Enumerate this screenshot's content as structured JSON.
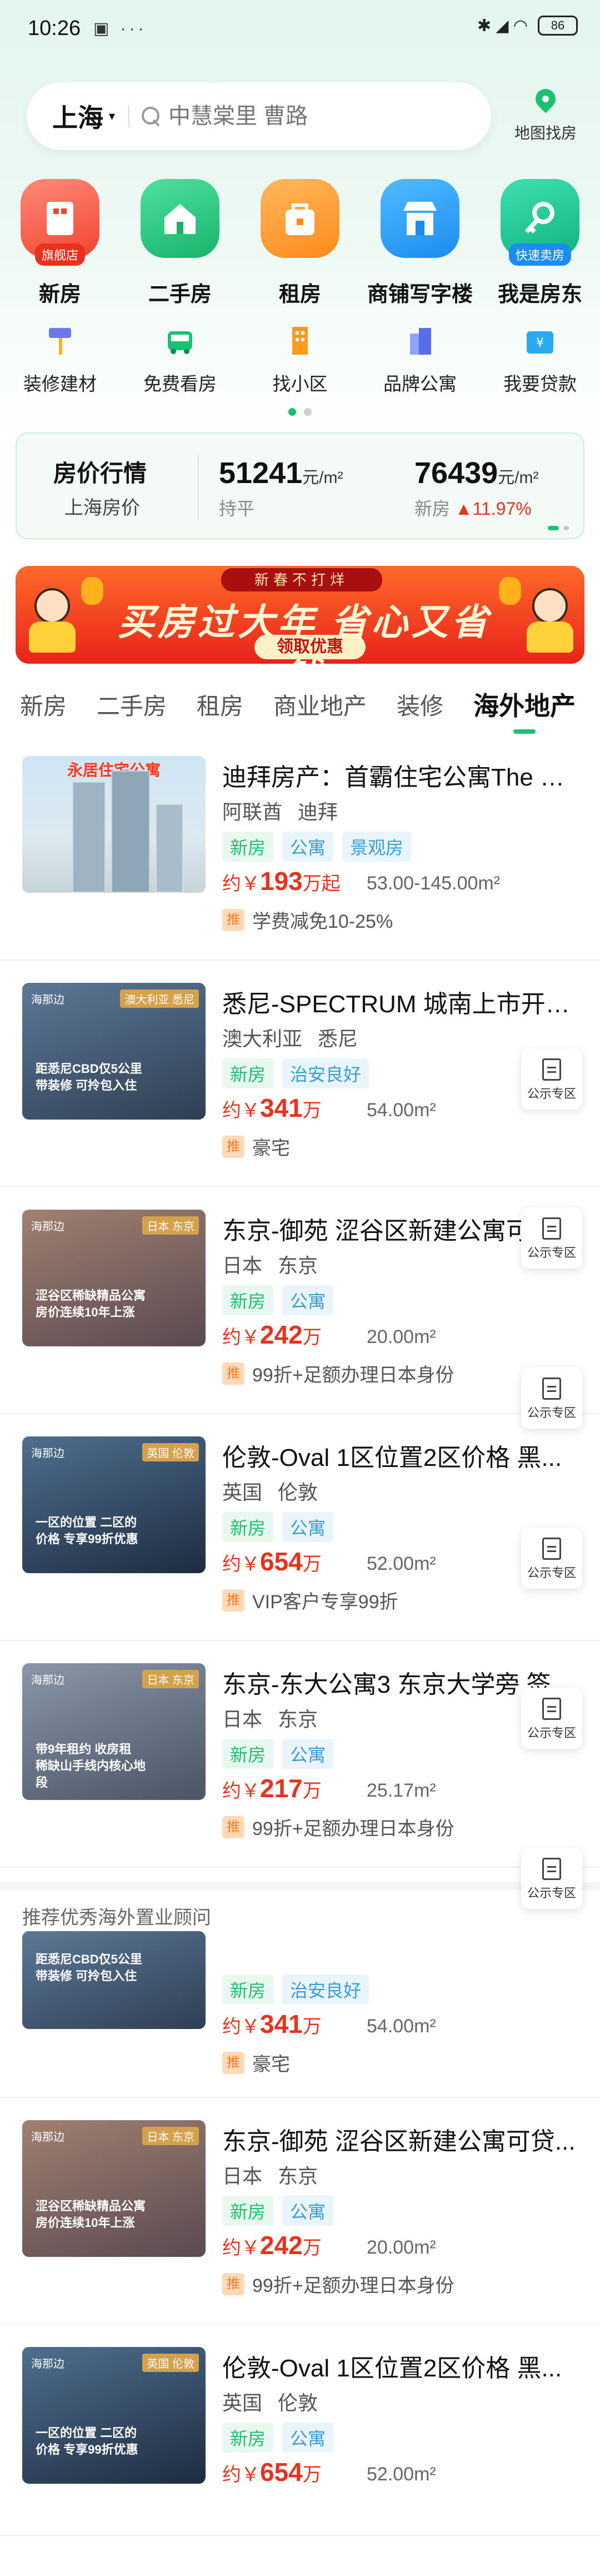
{
  "status": {
    "time": "10:26",
    "left_icons": "▣ ···",
    "right_icons": "✱ ◢ ◠",
    "battery": "86"
  },
  "search": {
    "city": "上海",
    "placeholder": "中慧棠里 曹路",
    "map_label": "地图找房"
  },
  "main_icons": [
    {
      "label": "新房",
      "badge": "旗舰店",
      "icon": "building-icon"
    },
    {
      "label": "二手房",
      "icon": "house-icon"
    },
    {
      "label": "租房",
      "icon": "bag-icon"
    },
    {
      "label": "商铺写字楼",
      "icon": "shop-icon"
    },
    {
      "label": "我是房东",
      "badge": "快速卖房",
      "icon": "key-icon"
    }
  ],
  "sub_icons": [
    {
      "label": "装修建材",
      "icon": "roller-icon"
    },
    {
      "label": "免费看房",
      "icon": "car-icon"
    },
    {
      "label": "找小区",
      "icon": "community-icon"
    },
    {
      "label": "品牌公寓",
      "icon": "apartment-icon"
    },
    {
      "label": "我要贷款",
      "icon": "loan-icon"
    }
  ],
  "price_card": {
    "title": "房价行情",
    "subtitle": "上海房价",
    "value1": "51241",
    "unit": "元/m²",
    "trend1": "持平",
    "value2": "76439",
    "trend2_label": "新房",
    "trend2_change": "▲11.97%"
  },
  "banner": {
    "top_text": "新春不打烊",
    "title": "买房过大年 省心又省钱",
    "button": "领取优惠"
  },
  "tabs": [
    "新房",
    "二手房",
    "租房",
    "商业地产",
    "装修",
    "海外地产"
  ],
  "listings": [
    {
      "title": "迪拜房产：首霸住宅公寓The C...",
      "country": "阿联酋",
      "city": "迪拜",
      "tags": [
        "新房",
        "公寓",
        "景观房"
      ],
      "price_prefix": "约￥",
      "price": "193",
      "price_suffix": "万起",
      "area": "53.00-145.00m²",
      "rec": "学费减免10-25%",
      "thumb_title": "永居住宅公寓"
    },
    {
      "title": "悉尼-SPECTRUM 城南上市开发...",
      "country": "澳大利亚",
      "city": "悉尼",
      "tags": [
        "新房",
        "治安良好"
      ],
      "price_prefix": "约￥",
      "price": "341",
      "price_suffix": "万",
      "area": "54.00m²",
      "rec": "豪宅",
      "thumb_brand": "海那边",
      "thumb_loc": "澳大利亚 悉尼",
      "thumb_caption": "距悉尼CBD仅5公里 带装修 可拎包入住"
    },
    {
      "title": "东京-御苑 涩谷区新建公寓可贷...",
      "country": "日本",
      "city": "东京",
      "tags": [
        "新房",
        "公寓"
      ],
      "price_prefix": "约￥",
      "price": "242",
      "price_suffix": "万",
      "area": "20.00m²",
      "rec": "99折+足额办理日本身份",
      "thumb_brand": "海那边",
      "thumb_loc": "日本 东京",
      "thumb_caption": "涩谷区稀缺精品公寓 房价连续10年上涨"
    },
    {
      "title": "伦敦-Oval 1区位置2区价格 黑...",
      "country": "英国",
      "city": "伦敦",
      "tags": [
        "新房",
        "公寓"
      ],
      "price_prefix": "约￥",
      "price": "654",
      "price_suffix": "万",
      "area": "52.00m²",
      "rec": "VIP客户专享99折",
      "thumb_brand": "海那边",
      "thumb_loc": "英国 伦敦",
      "thumb_caption": "一区的位置 二区的价格 专享99折优惠"
    },
    {
      "title": "东京-东大公寓3 东京大学旁 签...",
      "country": "日本",
      "city": "东京",
      "tags": [
        "新房",
        "公寓"
      ],
      "price_prefix": "约￥",
      "price": "217",
      "price_suffix": "万",
      "area": "25.17m²",
      "rec": "99折+足额办理日本身份",
      "thumb_brand": "海那边",
      "thumb_loc": "日本 东京",
      "thumb_caption": "带9年租约 收房租 稀缺山手线内核心地段"
    }
  ],
  "public_label": "公示专区",
  "recommend_text": "推荐优秀海外置业顾问",
  "listings_b": [
    {
      "title": "",
      "country": "",
      "city": "",
      "tags": [
        "新房",
        "治安良好"
      ],
      "price_prefix": "约￥",
      "price": "341",
      "price_suffix": "万",
      "area": "54.00m²",
      "rec": "豪宅",
      "thumb_caption": "距悉尼CBD仅5公里 带装修 可拎包入住"
    },
    {
      "title": "东京-御苑 涩谷区新建公寓可贷...",
      "country": "日本",
      "city": "东京",
      "tags": [
        "新房",
        "公寓"
      ],
      "price_prefix": "约￥",
      "price": "242",
      "price_suffix": "万",
      "area": "20.00m²",
      "rec": "99折+足额办理日本身份",
      "thumb_brand": "海那边",
      "thumb_loc": "日本 东京",
      "thumb_caption": "涩谷区稀缺精品公寓 房价连续10年上涨"
    },
    {
      "title": "伦敦-Oval 1区位置2区价格 黑...",
      "country": "英国",
      "city": "伦敦",
      "tags": [
        "新房",
        "公寓"
      ],
      "price_prefix": "约￥",
      "price": "654",
      "price_suffix": "万",
      "area": "52.00m²",
      "thumb_brand": "海那边",
      "thumb_loc": "英国 伦敦",
      "thumb_caption": "一区的位置 二区的价格 专享99折优惠"
    }
  ],
  "colors": {
    "accent": "#1dbf73",
    "price": "#e8321e",
    "tag_green_bg": "#e8f8ee",
    "tag_blue": "#3b9dd6"
  }
}
